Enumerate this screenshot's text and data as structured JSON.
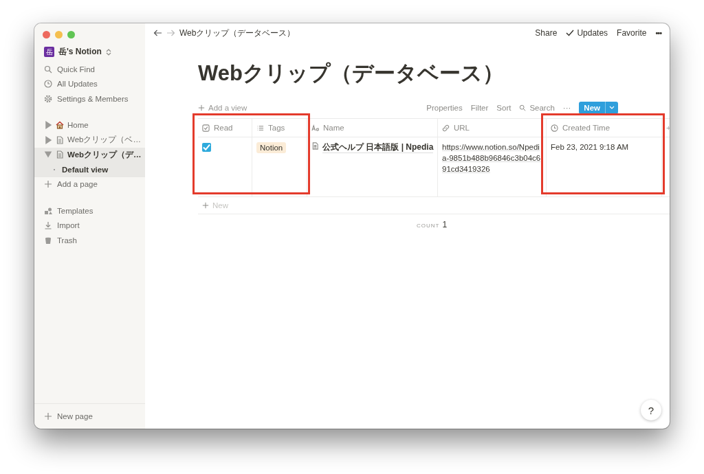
{
  "workspace": {
    "name": "岳's Notion",
    "icon": "岳"
  },
  "sidebar": {
    "menu": [
      "Quick Find",
      "All Updates",
      "Settings & Members"
    ],
    "pages": [
      {
        "label": "Home",
        "expanded": false,
        "selected": false
      },
      {
        "label": "Webクリップ（ベ…",
        "expanded": false,
        "selected": false
      },
      {
        "label": "Webクリップ（デ…",
        "expanded": true,
        "selected": true,
        "children": [
          {
            "label": "Default view",
            "selected": true
          }
        ]
      }
    ],
    "add_page": "Add a page",
    "tools": [
      "Templates",
      "Import",
      "Trash"
    ],
    "new_page": "New page"
  },
  "topbar": {
    "breadcrumb": "Webクリップ（データベース）",
    "actions": [
      "Share",
      "Updates",
      "Favorite"
    ],
    "more": "•••"
  },
  "title": "Webクリップ（データベース）",
  "toolbar": {
    "add_view": "Add a view",
    "items": [
      "Properties",
      "Filter",
      "Sort"
    ],
    "search": "Search",
    "more": "···",
    "new_button": "New"
  },
  "table": {
    "columns": [
      {
        "label": "Read",
        "highlighted": true
      },
      {
        "label": "Tags",
        "highlighted": true
      },
      {
        "label": "Name",
        "highlighted": false
      },
      {
        "label": "URL",
        "highlighted": false
      },
      {
        "label": "Created Time",
        "highlighted": true
      }
    ],
    "add_column": "+",
    "rows": [
      {
        "read": true,
        "tags": [
          {
            "label": "Notion",
            "color": "#fbecd7"
          }
        ],
        "name": "公式ヘルプ 日本語版 | Npedia",
        "url": "https://www.notion.so/Npedia-9851b488b96846c3b04c691cd3419326",
        "created": "Feb 23, 2021 9:18 AM"
      }
    ],
    "new_row": "New",
    "count_label": "COUNT",
    "count": "1"
  },
  "help_button": "?"
}
